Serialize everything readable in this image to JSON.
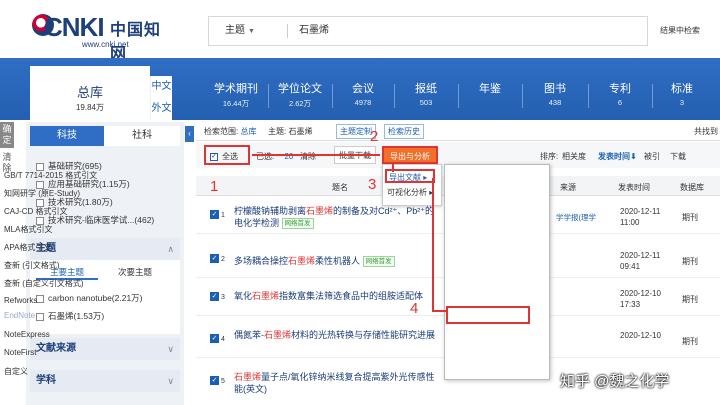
{
  "header": {
    "logo_cnki": "CNKI",
    "logo_cn": "中国知网",
    "logo_url": "www.cnki.net",
    "search_field": "主题",
    "search_query": "石墨烯",
    "search_within": "结果中检索"
  },
  "db_bar": {
    "zongku_label": "总库",
    "zongku_count": "19.84万",
    "lang_zh": "中文",
    "lang_foreign": "外文",
    "databases": [
      {
        "label": "学术期刊",
        "count": "16.44万"
      },
      {
        "label": "学位论文",
        "count": "2.62万"
      },
      {
        "label": "会议",
        "count": "4978"
      },
      {
        "label": "报纸",
        "count": "503"
      },
      {
        "label": "年鉴",
        "count": ""
      },
      {
        "label": "图书",
        "count": "438"
      },
      {
        "label": "专利",
        "count": "6"
      },
      {
        "label": "标准",
        "count": "3"
      }
    ]
  },
  "sidebar": {
    "side_tabs": [
      "确定",
      "清除"
    ],
    "tab_keji": "科技",
    "tab_sheke": "社科",
    "subjects": [
      "基础研究(695)",
      "应用基础研究(1.15万)",
      "技术研究(1.80万)",
      "技术研究-临床医学试...(462)"
    ],
    "topic_header": "主题",
    "topic_tab_main": "主要主题",
    "topic_tab_sub": "次要主题",
    "topics": [
      "carbon nanotube(2.21万)",
      "石墨烯(1.53万)"
    ],
    "section_source": "文献来源",
    "section_discipline": "学科"
  },
  "toolbar": {
    "scope_label": "检索范围:",
    "scope_value": "总库",
    "scope_topic": "主题: 石墨烯",
    "topic_define": "主题定制",
    "history": "检索历史",
    "total_found": "共找到",
    "select_all": "全选",
    "selected_label": "已选:",
    "selected_count": "20",
    "clear": "清除",
    "bulk_download": "批量下载",
    "export": "导出与分析",
    "sort_label": "排序:",
    "sort_relevance": "相关度",
    "sort_date": "发表时间",
    "sort_cited": "被引",
    "sort_download": "下载"
  },
  "submenu": {
    "export_doc": "导出文献",
    "visual_analysis": "可视化分析"
  },
  "table": {
    "col_title": "题名",
    "col_source": "来源",
    "col_date": "发表时间",
    "col_db": "数据库"
  },
  "rows": [
    {
      "num": "1",
      "pre": "柠檬酸钠辅助剥离",
      "hl": "石墨烯",
      "post": "的制备及对Cd²⁺、Pb²⁺的电化学检测",
      "badge": "网络首发",
      "source": "学学报(理学",
      "date1": "2020-12-11",
      "date2": "11:00",
      "type": "期刊"
    },
    {
      "num": "2",
      "pre": "多场耦合操控",
      "hl": "石墨烯",
      "post": "柔性机器人",
      "badge": "网络首发",
      "source": "",
      "date1": "2020-12-11",
      "date2": "09:41",
      "type": "期刊"
    },
    {
      "num": "3",
      "pre": "氧化",
      "hl": "石墨烯",
      "post": "指数富集法筛选食品中的组胺适配体",
      "badge": "",
      "source": "",
      "date1": "2020-12-10",
      "date2": "17:33",
      "type": "期刊"
    },
    {
      "num": "4",
      "pre": "偶氮苯-",
      "hl": "石墨烯",
      "post": "材料的光热转换与存储性能研究进展",
      "badge": "",
      "source": "",
      "date1": "2020-12-10",
      "date2": "",
      "type": "期刊"
    },
    {
      "num": "5",
      "pre": "",
      "hl": "石墨烯",
      "post": "量子点/氧化锌纳米线复合提高紫外光传感性能(英文)",
      "badge": "",
      "source": "",
      "date1": "",
      "date2": "",
      "type": ""
    }
  ],
  "export_menu": {
    "items": [
      "GB/T 7714-2015 格式引文",
      "知网研学 (原E-Study)",
      "CAJ-CD 格式引文",
      "MLA格式引文",
      "APA格式引文",
      "查新 (引文格式)",
      "查新 (自定义引文格式)",
      "Refworks",
      "EndNote",
      "NoteExpress",
      "NoteFirst",
      "自定义"
    ]
  },
  "annotations": {
    "n1": "1",
    "n2": "2",
    "n3": "3",
    "n4": "4"
  },
  "watermark": "知乎 @魏之化学",
  "colors": {
    "brand_blue": "#2f6ec4",
    "export_orange": "#f0702a",
    "highlight_red": "#e03434",
    "title_blue": "#1a3c7a"
  }
}
